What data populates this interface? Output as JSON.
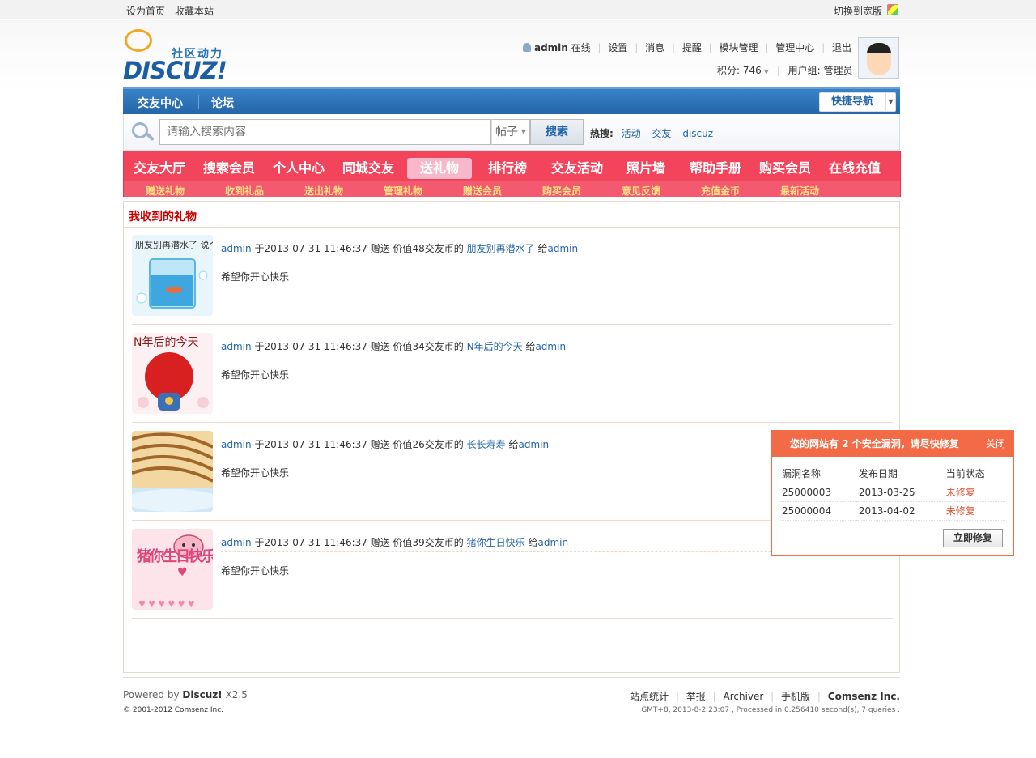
{
  "topbar": {
    "set_home": "设为首页",
    "bookmark": "收藏本站",
    "switch_wide": "切换到宽版"
  },
  "logo": {
    "slogan": "社区动力",
    "word": "DISCUZ!"
  },
  "user": {
    "name": "admin",
    "status": "在线",
    "links": [
      "设置",
      "消息",
      "提醒",
      "模块管理",
      "管理中心",
      "退出"
    ],
    "points_label": "积分: 746",
    "group_label": "用户组: 管理员"
  },
  "nav": {
    "items": [
      "交友中心",
      "论坛"
    ],
    "quick_nav": "快捷导航"
  },
  "search": {
    "placeholder": "请输入搜索内容",
    "type": "帖子",
    "button": "搜索",
    "hot_label": "热搜:",
    "hot_terms": [
      "活动",
      "交友",
      "discuz"
    ]
  },
  "menu": {
    "main": [
      "交友大厅",
      "搜索会员",
      "个人中心",
      "同城交友",
      "送礼物",
      "排行榜",
      "交友活动",
      "照片墙",
      "帮助手册",
      "购买会员",
      "在线充值"
    ],
    "active": "送礼物",
    "sub": [
      "赠送礼物",
      "收到礼品",
      "送出礼物",
      "管理礼物",
      "赠送会员",
      "购买会员",
      "意见反馈",
      "充值金币",
      "最新活动"
    ]
  },
  "content": {
    "title": "我收到的礼物",
    "gifts": [
      {
        "sender": "admin",
        "time": "于2013-07-31 11:46:37 赠送 价值48交友币的",
        "gift": "朋友别再潜水了",
        "to_prefix": "给",
        "to": "admin",
        "message": "希望你开心快乐",
        "thumb_text": "朋友别再潜水了 说个话嘛"
      },
      {
        "sender": "admin",
        "time": "于2013-07-31 11:46:37 赠送 价值34交友币的",
        "gift": "N年后的今天",
        "to_prefix": "给",
        "to": "admin",
        "message": "希望你开心快乐",
        "thumb_text": "N年后的今天"
      },
      {
        "sender": "admin",
        "time": "于2013-07-31 11:46:37 赠送 价值26交友币的",
        "gift": "长长寿寿",
        "to_prefix": "给",
        "to": "admin",
        "message": "希望你开心快乐",
        "thumb_text": ""
      },
      {
        "sender": "admin",
        "time": "于2013-07-31 11:46:37 赠送 价值39交友币的",
        "gift": "猪你生日快乐",
        "to_prefix": "给",
        "to": "admin",
        "message": "希望你开心快乐",
        "thumb_text": "猪你生日快乐"
      }
    ]
  },
  "footer": {
    "powered_prefix": "Powered by",
    "powered_brand": "Discuz!",
    "powered_version": "X2.5",
    "copyright": "© 2001-2012 Comsenz Inc.",
    "links": [
      "站点统计",
      "举报",
      "Archiver",
      "手机版"
    ],
    "company": "Comsenz Inc.",
    "info": "GMT+8, 2013-8-2 23:07 , Processed in 0.256410 second(s), 7 queries ."
  },
  "popup": {
    "title": "您的网站有 2 个安全漏洞，请尽快修复",
    "close": "关闭",
    "headers": [
      "漏洞名称",
      "发布日期",
      "当前状态"
    ],
    "rows": [
      [
        "25000003",
        "2013-03-25",
        "未修复"
      ],
      [
        "25000004",
        "2013-04-02",
        "未修复"
      ]
    ],
    "fix_button": "立即修复"
  },
  "colors": {
    "brand_blue": "#2466a8",
    "menu_red": "#f2455c",
    "sub_yellow": "#ffe082",
    "alert_orange": "#f26b46",
    "title_red": "#cc0000"
  }
}
